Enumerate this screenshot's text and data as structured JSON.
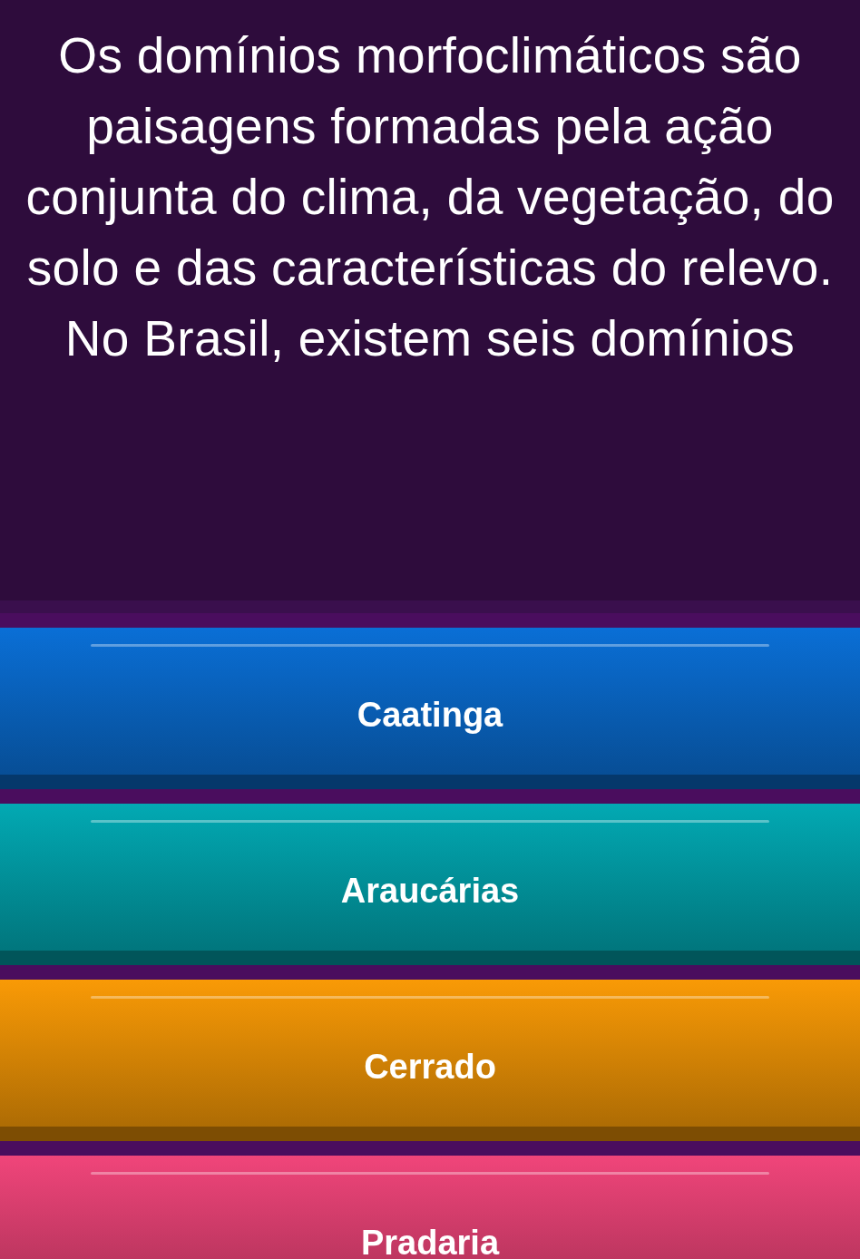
{
  "question": {
    "text": "Os domínios morfoclimáticos são paisagens formadas pela ação conjunta do clima, da vegetação, do solo e das características do relevo. No Brasil, existem seis domínios"
  },
  "answers": [
    {
      "label": "Caatinga",
      "color": "#0a6fd6"
    },
    {
      "label": "Araucárias",
      "color": "#02a9b3"
    },
    {
      "label": "Cerrado",
      "color": "#f99a06"
    },
    {
      "label": "Pradaria",
      "color": "#f0457a"
    }
  ]
}
